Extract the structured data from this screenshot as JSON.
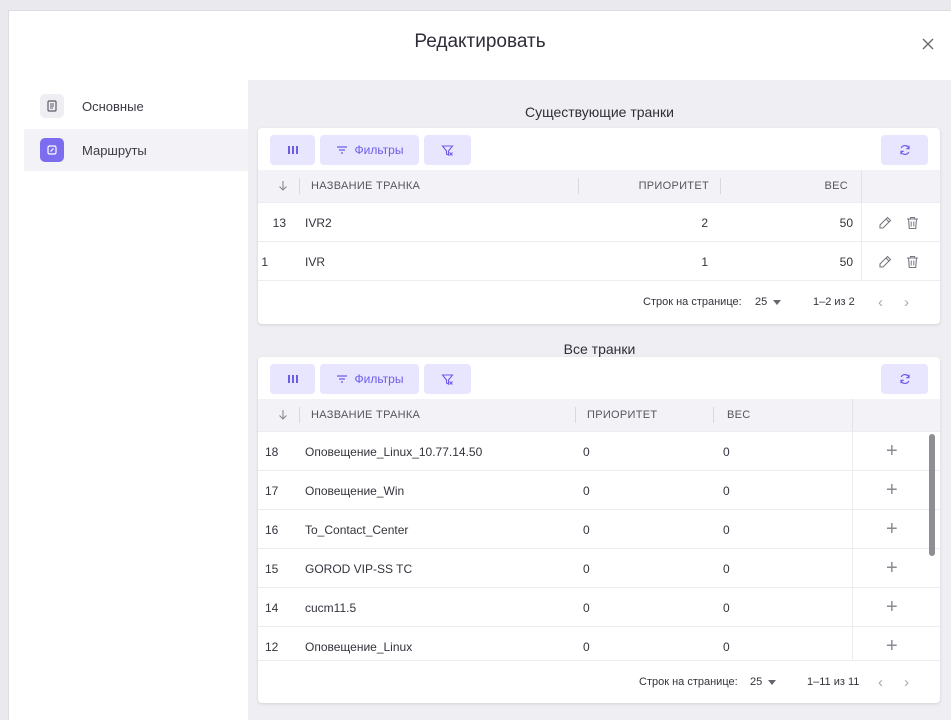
{
  "dialog": {
    "title": "Редактировать"
  },
  "sidebar": {
    "items": [
      {
        "label": "Основные",
        "icon": "document-icon"
      },
      {
        "label": "Маршруты",
        "icon": "route-icon"
      }
    ]
  },
  "existing": {
    "title": "Существующие транки",
    "toolbar": {
      "filters_label": "Фильтры"
    },
    "columns": {
      "name": "НАЗВАНИЕ ТРАНКА",
      "priority": "ПРИОРИТЕТ",
      "weight": "ВЕС"
    },
    "rows": [
      {
        "id": "13",
        "name": "IVR2",
        "priority": "2",
        "weight": "50"
      },
      {
        "id": "1",
        "name": "IVR",
        "priority": "1",
        "weight": "50"
      }
    ],
    "pagination": {
      "rows_label": "Строк на странице:",
      "per_page": "25",
      "range": "1–2 из 2"
    }
  },
  "all": {
    "title": "Все транки",
    "toolbar": {
      "filters_label": "Фильтры"
    },
    "columns": {
      "name": "НАЗВАНИЕ ТРАНКА",
      "priority": "ПРИОРИТЕТ",
      "weight": "ВЕС"
    },
    "rows": [
      {
        "id": "18",
        "name": "Оповещение_Linux_10.77.14.50",
        "priority": "0",
        "weight": "0"
      },
      {
        "id": "17",
        "name": "Оповещение_Win",
        "priority": "0",
        "weight": "0"
      },
      {
        "id": "16",
        "name": "To_Contact_Center",
        "priority": "0",
        "weight": "0"
      },
      {
        "id": "15",
        "name": "GOROD VIP-SS TC",
        "priority": "0",
        "weight": "0"
      },
      {
        "id": "14",
        "name": "cucm11.5",
        "priority": "0",
        "weight": "0"
      },
      {
        "id": "12",
        "name": "Оповещение_Linux",
        "priority": "0",
        "weight": "0"
      }
    ],
    "add_symbol": "+",
    "pagination": {
      "rows_label": "Строк на странице:",
      "per_page": "25",
      "range": "1–11 из 11"
    }
  },
  "colors": {
    "accent": "#7b6cf0",
    "accent_light": "#e8e5ff",
    "background": "#efeff3"
  }
}
